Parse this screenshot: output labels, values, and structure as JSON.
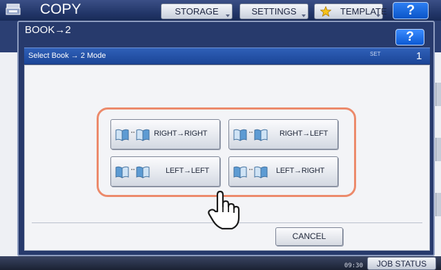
{
  "header": {
    "title": "COPY",
    "storage_label": "STORAGE",
    "settings_label": "SETTINGS",
    "template_label": "TEMPLATE",
    "help_label": "?"
  },
  "dialog": {
    "title": "BOOK→2",
    "help_label": "?",
    "mode_label": "Select Book → 2 Mode",
    "set_label": "SET",
    "set_count": "1",
    "options": [
      {
        "label": "RIGHT→RIGHT"
      },
      {
        "label": "RIGHT→LEFT"
      },
      {
        "label": "LEFT→LEFT"
      },
      {
        "label": "LEFT→RIGHT"
      }
    ],
    "cancel_label": "CANCEL"
  },
  "status_bar": {
    "time": "09:30",
    "job_status_label": "JOB STATUS"
  },
  "colors": {
    "highlight_ring": "#ec8a6b",
    "title_bar": "#23376a",
    "mode_bar": "#1b4597",
    "book_icon": "#5d9bd3"
  }
}
